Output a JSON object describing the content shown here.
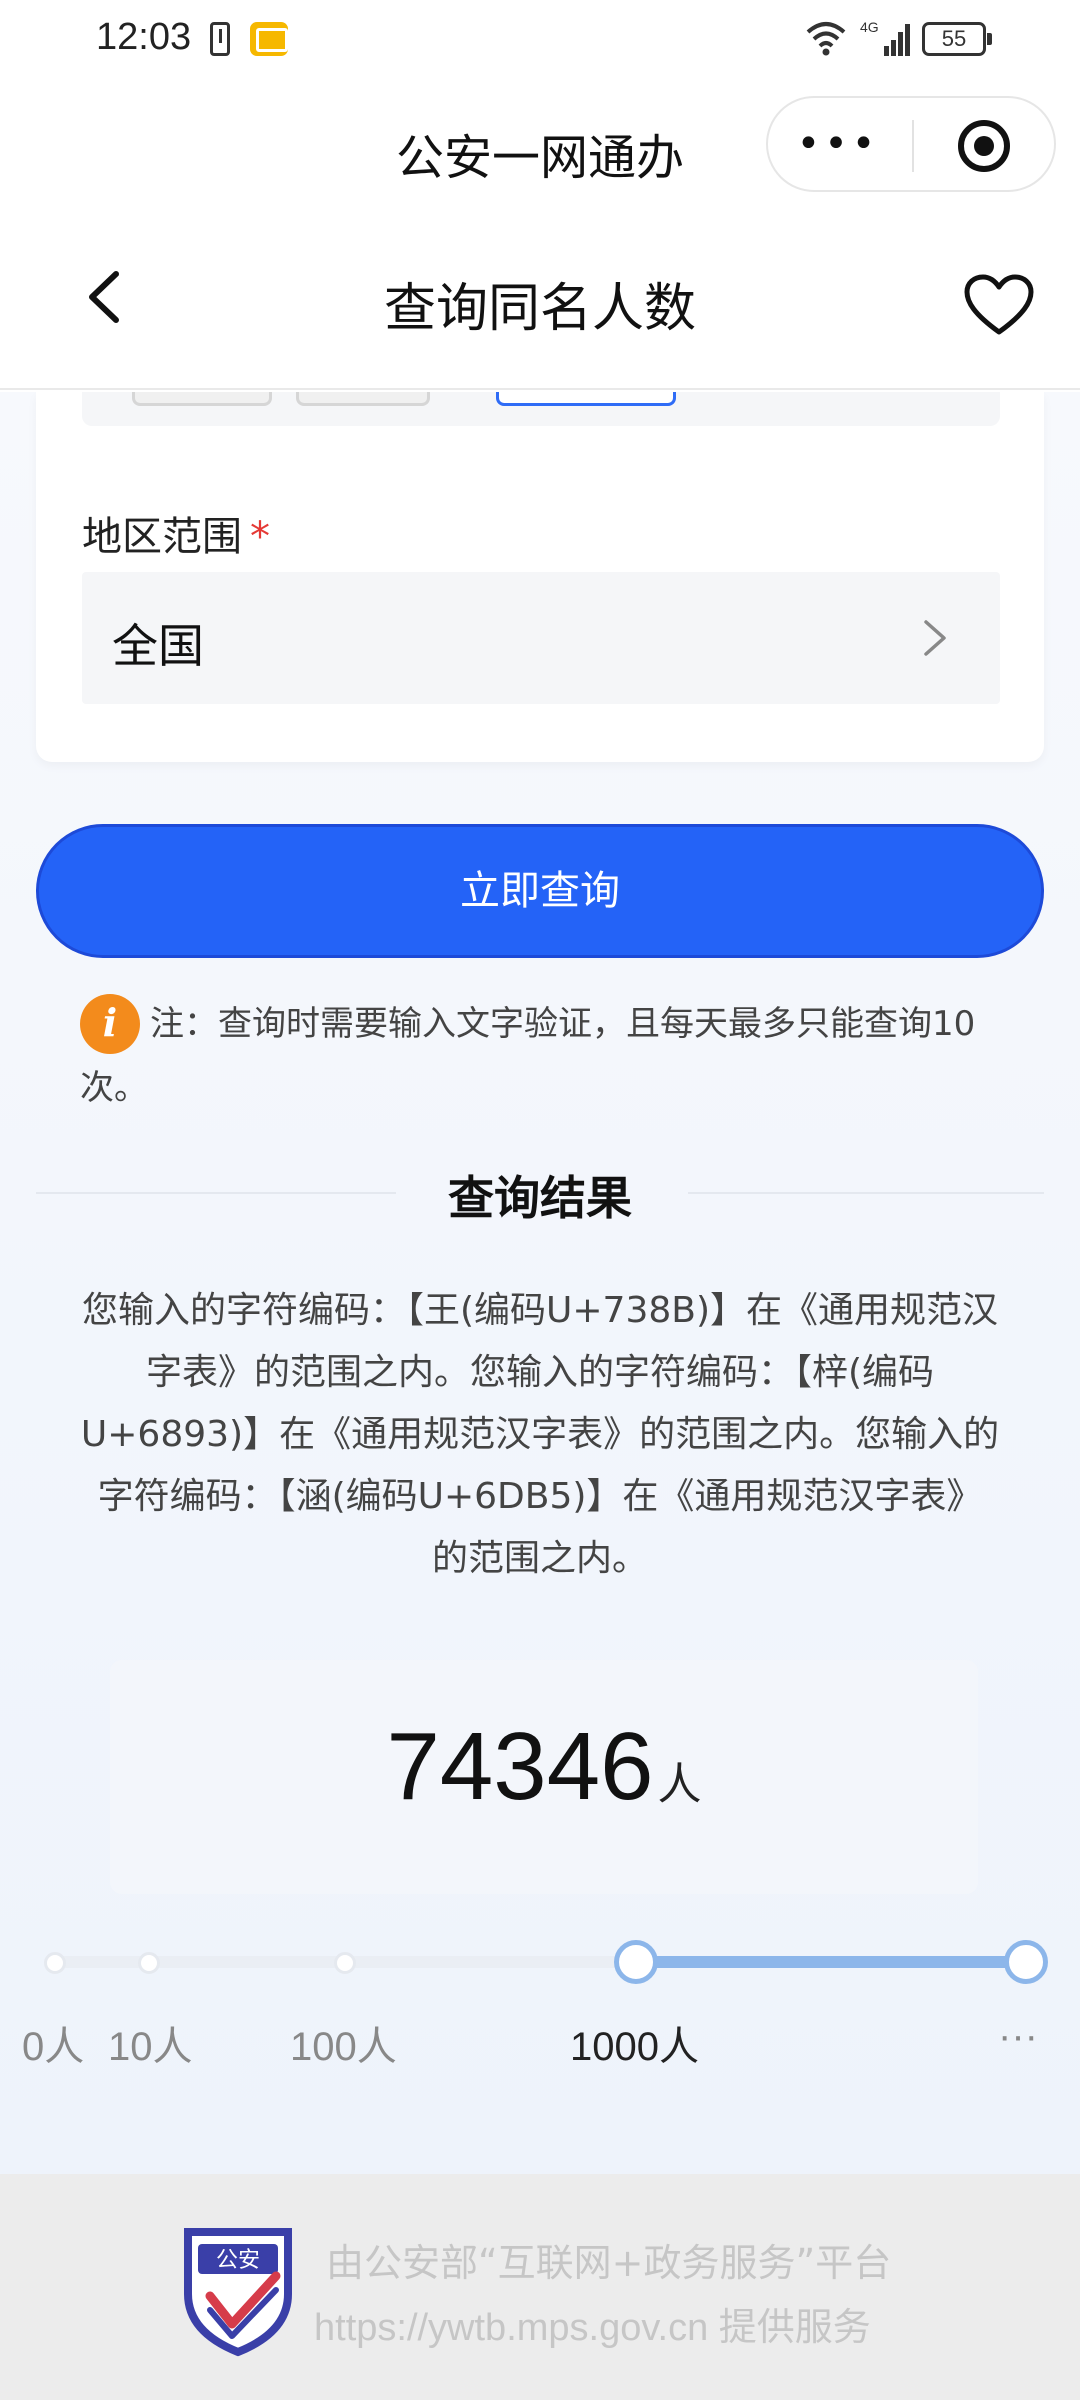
{
  "status_bar": {
    "time": "12:03",
    "network": "4G",
    "battery": "55"
  },
  "mini_program": {
    "title": "公安一网通办",
    "menu_dots": "•••"
  },
  "nav": {
    "title": "查询同名人数"
  },
  "form": {
    "region_label": "地区范围",
    "required_mark": "*",
    "region_value": "全国"
  },
  "actions": {
    "query_label": "立即查询"
  },
  "note": {
    "icon_letter": "i",
    "text": "注：查询时需要输入文字验证，且每天最多只能查询10次。"
  },
  "result": {
    "title": "查询结果",
    "description": "您输入的字符编码：【王(编码U+738B)】在《通用规范汉字表》的范围之内。您输入的字符编码：【梓(编码U+6893)】在《通用规范汉字表》的范围之内。您输入的字符编码：【涵(编码U+6DB5)】在《通用规范汉字表》的范围之内。",
    "count": "74346",
    "unit": "人"
  },
  "scale": {
    "labels": [
      "0人",
      "10人",
      "100人",
      "1000人",
      "···"
    ],
    "active_index": 3
  },
  "footer": {
    "logo_text": "公安",
    "line1": "由公安部“互联网+政务服务”平台",
    "line2": "https://ywtb.mps.gov.cn 提供服务"
  },
  "colors": {
    "primary": "#2463f7",
    "accent_orange": "#f38b1c",
    "scale_active": "#8cb6ea"
  }
}
